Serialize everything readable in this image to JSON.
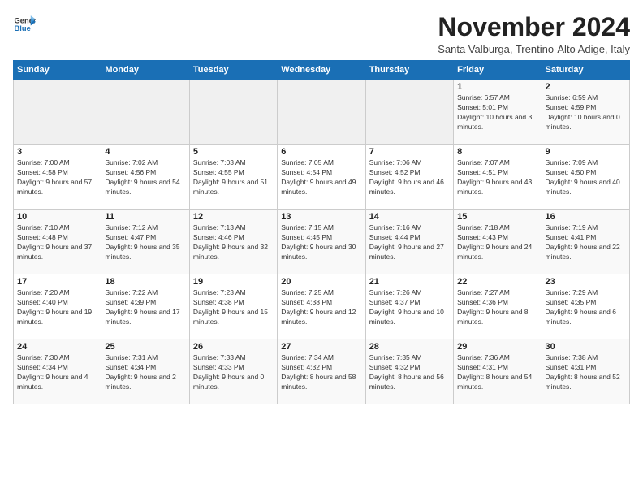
{
  "logo": {
    "line1": "General",
    "line2": "Blue"
  },
  "title": "November 2024",
  "subtitle": "Santa Valburga, Trentino-Alto Adige, Italy",
  "days_of_week": [
    "Sunday",
    "Monday",
    "Tuesday",
    "Wednesday",
    "Thursday",
    "Friday",
    "Saturday"
  ],
  "weeks": [
    [
      {
        "day": "",
        "info": ""
      },
      {
        "day": "",
        "info": ""
      },
      {
        "day": "",
        "info": ""
      },
      {
        "day": "",
        "info": ""
      },
      {
        "day": "",
        "info": ""
      },
      {
        "day": "1",
        "info": "Sunrise: 6:57 AM\nSunset: 5:01 PM\nDaylight: 10 hours and 3 minutes."
      },
      {
        "day": "2",
        "info": "Sunrise: 6:59 AM\nSunset: 4:59 PM\nDaylight: 10 hours and 0 minutes."
      }
    ],
    [
      {
        "day": "3",
        "info": "Sunrise: 7:00 AM\nSunset: 4:58 PM\nDaylight: 9 hours and 57 minutes."
      },
      {
        "day": "4",
        "info": "Sunrise: 7:02 AM\nSunset: 4:56 PM\nDaylight: 9 hours and 54 minutes."
      },
      {
        "day": "5",
        "info": "Sunrise: 7:03 AM\nSunset: 4:55 PM\nDaylight: 9 hours and 51 minutes."
      },
      {
        "day": "6",
        "info": "Sunrise: 7:05 AM\nSunset: 4:54 PM\nDaylight: 9 hours and 49 minutes."
      },
      {
        "day": "7",
        "info": "Sunrise: 7:06 AM\nSunset: 4:52 PM\nDaylight: 9 hours and 46 minutes."
      },
      {
        "day": "8",
        "info": "Sunrise: 7:07 AM\nSunset: 4:51 PM\nDaylight: 9 hours and 43 minutes."
      },
      {
        "day": "9",
        "info": "Sunrise: 7:09 AM\nSunset: 4:50 PM\nDaylight: 9 hours and 40 minutes."
      }
    ],
    [
      {
        "day": "10",
        "info": "Sunrise: 7:10 AM\nSunset: 4:48 PM\nDaylight: 9 hours and 37 minutes."
      },
      {
        "day": "11",
        "info": "Sunrise: 7:12 AM\nSunset: 4:47 PM\nDaylight: 9 hours and 35 minutes."
      },
      {
        "day": "12",
        "info": "Sunrise: 7:13 AM\nSunset: 4:46 PM\nDaylight: 9 hours and 32 minutes."
      },
      {
        "day": "13",
        "info": "Sunrise: 7:15 AM\nSunset: 4:45 PM\nDaylight: 9 hours and 30 minutes."
      },
      {
        "day": "14",
        "info": "Sunrise: 7:16 AM\nSunset: 4:44 PM\nDaylight: 9 hours and 27 minutes."
      },
      {
        "day": "15",
        "info": "Sunrise: 7:18 AM\nSunset: 4:43 PM\nDaylight: 9 hours and 24 minutes."
      },
      {
        "day": "16",
        "info": "Sunrise: 7:19 AM\nSunset: 4:41 PM\nDaylight: 9 hours and 22 minutes."
      }
    ],
    [
      {
        "day": "17",
        "info": "Sunrise: 7:20 AM\nSunset: 4:40 PM\nDaylight: 9 hours and 19 minutes."
      },
      {
        "day": "18",
        "info": "Sunrise: 7:22 AM\nSunset: 4:39 PM\nDaylight: 9 hours and 17 minutes."
      },
      {
        "day": "19",
        "info": "Sunrise: 7:23 AM\nSunset: 4:38 PM\nDaylight: 9 hours and 15 minutes."
      },
      {
        "day": "20",
        "info": "Sunrise: 7:25 AM\nSunset: 4:38 PM\nDaylight: 9 hours and 12 minutes."
      },
      {
        "day": "21",
        "info": "Sunrise: 7:26 AM\nSunset: 4:37 PM\nDaylight: 9 hours and 10 minutes."
      },
      {
        "day": "22",
        "info": "Sunrise: 7:27 AM\nSunset: 4:36 PM\nDaylight: 9 hours and 8 minutes."
      },
      {
        "day": "23",
        "info": "Sunrise: 7:29 AM\nSunset: 4:35 PM\nDaylight: 9 hours and 6 minutes."
      }
    ],
    [
      {
        "day": "24",
        "info": "Sunrise: 7:30 AM\nSunset: 4:34 PM\nDaylight: 9 hours and 4 minutes."
      },
      {
        "day": "25",
        "info": "Sunrise: 7:31 AM\nSunset: 4:34 PM\nDaylight: 9 hours and 2 minutes."
      },
      {
        "day": "26",
        "info": "Sunrise: 7:33 AM\nSunset: 4:33 PM\nDaylight: 9 hours and 0 minutes."
      },
      {
        "day": "27",
        "info": "Sunrise: 7:34 AM\nSunset: 4:32 PM\nDaylight: 8 hours and 58 minutes."
      },
      {
        "day": "28",
        "info": "Sunrise: 7:35 AM\nSunset: 4:32 PM\nDaylight: 8 hours and 56 minutes."
      },
      {
        "day": "29",
        "info": "Sunrise: 7:36 AM\nSunset: 4:31 PM\nDaylight: 8 hours and 54 minutes."
      },
      {
        "day": "30",
        "info": "Sunrise: 7:38 AM\nSunset: 4:31 PM\nDaylight: 8 hours and 52 minutes."
      }
    ]
  ]
}
